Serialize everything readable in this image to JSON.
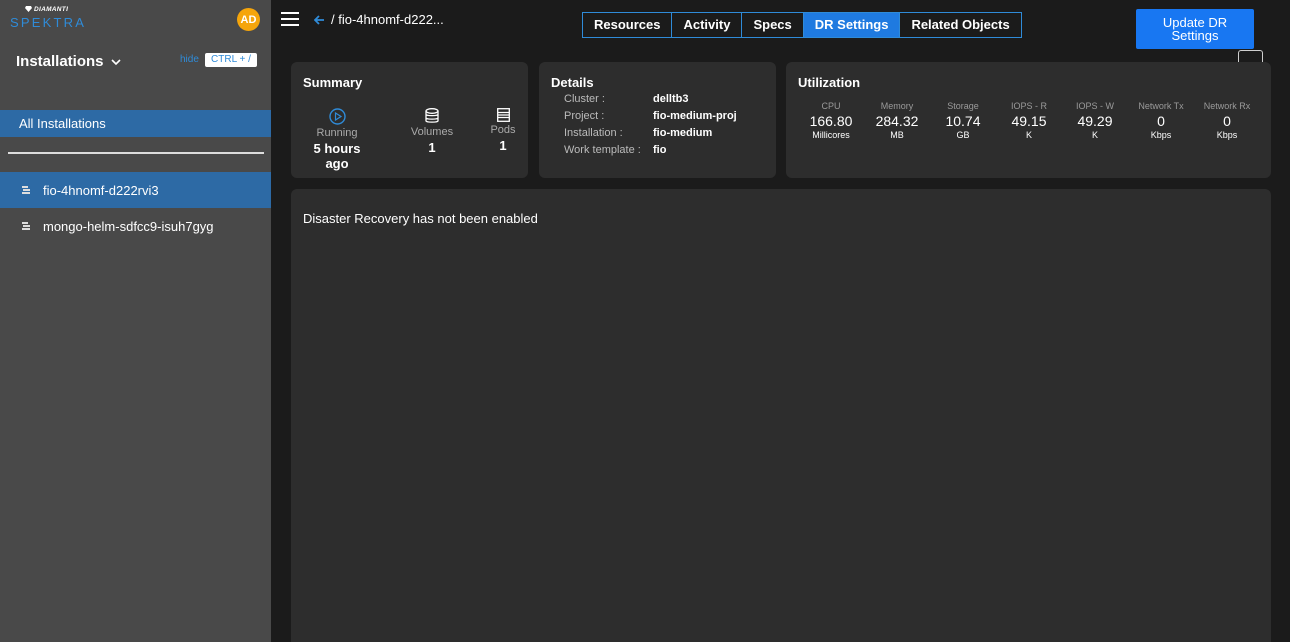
{
  "brand": {
    "top": "DIAMANTI",
    "main": "SPEKTRA"
  },
  "user": {
    "initials": "AD"
  },
  "sidebar": {
    "title": "Installations",
    "hide_label": "hide",
    "shortcut": "CTRL + /",
    "all_label": "All Installations",
    "items": [
      {
        "label": "fio-4hnomf-d222rvi3",
        "active": true
      },
      {
        "label": "mongo-helm-sdfcc9-isuh7gyg",
        "active": false
      }
    ]
  },
  "breadcrumb": {
    "sep": "/",
    "label": "fio-4hnomf-d222..."
  },
  "tabs": [
    "Resources",
    "Activity",
    "Specs",
    "DR Settings",
    "Related Objects"
  ],
  "active_tab": "DR Settings",
  "update_button": {
    "line1": "Update DR",
    "line2": "Settings"
  },
  "summary": {
    "title": "Summary",
    "running": {
      "label": "Running",
      "value": "5 hours ago"
    },
    "volumes": {
      "label": "Volumes",
      "value": "1"
    },
    "pods": {
      "label": "Pods",
      "value": "1"
    }
  },
  "details": {
    "title": "Details",
    "rows": [
      {
        "label": "Cluster :",
        "value": "delltb3"
      },
      {
        "label": "Project :",
        "value": "fio-medium-proj"
      },
      {
        "label": "Installation :",
        "value": "fio-medium"
      },
      {
        "label": "Work template :",
        "value": "fio"
      }
    ]
  },
  "utilization": {
    "title": "Utilization",
    "metrics": [
      {
        "label": "CPU",
        "value": "166.80",
        "unit": "Millicores"
      },
      {
        "label": "Memory",
        "value": "284.32",
        "unit": "MB"
      },
      {
        "label": "Storage",
        "value": "10.74",
        "unit": "GB"
      },
      {
        "label": "IOPS - R",
        "value": "49.15",
        "unit": "K"
      },
      {
        "label": "IOPS - W",
        "value": "49.29",
        "unit": "K"
      },
      {
        "label": "Network Tx",
        "value": "0",
        "unit": "Kbps"
      },
      {
        "label": "Network Rx",
        "value": "0",
        "unit": "Kbps"
      }
    ]
  },
  "main": {
    "message": "Disaster Recovery has not been enabled"
  },
  "colors": {
    "accent": "#1877f2",
    "sidebar_bg": "#494949",
    "selected": "#2d6aa5",
    "avatar": "#f5a50b",
    "card": "#2d2d2d",
    "bg": "#1b1b1b"
  }
}
